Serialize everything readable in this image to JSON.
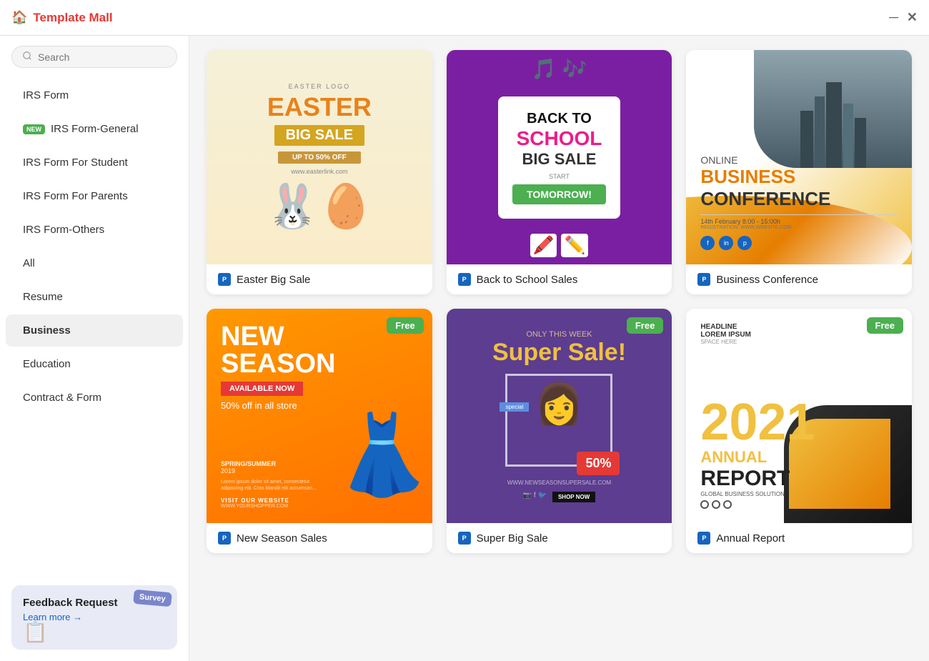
{
  "app": {
    "title": "Template Mall",
    "minimize_label": "minimize",
    "close_label": "close"
  },
  "search": {
    "placeholder": "Search"
  },
  "sidebar": {
    "items": [
      {
        "id": "irs-form",
        "label": "IRS Form",
        "active": false,
        "badge": null
      },
      {
        "id": "irs-form-general",
        "label": "IRS Form-General",
        "active": false,
        "badge": "NEW"
      },
      {
        "id": "irs-form-student",
        "label": "IRS Form For Student",
        "active": false,
        "badge": null
      },
      {
        "id": "irs-form-parents",
        "label": "IRS Form For Parents",
        "active": false,
        "badge": null
      },
      {
        "id": "irs-form-others",
        "label": "IRS Form-Others",
        "active": false,
        "badge": null
      },
      {
        "id": "all",
        "label": "All",
        "active": false,
        "badge": null
      },
      {
        "id": "resume",
        "label": "Resume",
        "active": false,
        "badge": null
      },
      {
        "id": "business",
        "label": "Business",
        "active": true,
        "badge": null
      },
      {
        "id": "education",
        "label": "Education",
        "active": false,
        "badge": null
      },
      {
        "id": "contract-form",
        "label": "Contract & Form",
        "active": false,
        "badge": null
      }
    ],
    "feedback": {
      "title": "Feedback Request",
      "link_label": "Learn more →",
      "survey_label": "Survey"
    }
  },
  "cards": [
    {
      "id": "easter-big-sale",
      "title": "Easter Big Sale",
      "type": "easter",
      "free": false,
      "details": {
        "logo": "EASTER LOGO",
        "main": "EASTER",
        "sub": "BIG SALE",
        "ribbon": "UP TO 50% OFF",
        "url": "www.easterlink.com"
      }
    },
    {
      "id": "back-to-school",
      "title": "Back to School Sales",
      "type": "school",
      "free": false,
      "details": {
        "back": "BACK TO",
        "school": "SCHOOL",
        "big": "BIG SALE",
        "start": "START",
        "tomorrow": "TOMORROW!"
      }
    },
    {
      "id": "business-conference",
      "title": "Business Conference",
      "type": "conference",
      "free": false,
      "details": {
        "online": "ONLINE",
        "business": "BUSINESS",
        "conference": "CONFERENCE",
        "date": "14th February  8:00 - 15:00h",
        "registration": "REGISTRATION: WWW.WEBSITE.COM"
      }
    },
    {
      "id": "new-season-sales",
      "title": "New Season Sales",
      "type": "newseason",
      "free": true,
      "details": {
        "new": "NEW",
        "season": "SEASON",
        "available": "AVAILABLE NOW",
        "off": "50% off in all store",
        "spring": "SPRING/SUMMER",
        "year": "2019",
        "visit": "VISIT OUR WEBSITE",
        "url": "WWW.YOURSHOPPER.COM"
      }
    },
    {
      "id": "super-big-sale",
      "title": "Super Big Sale",
      "type": "supersale",
      "free": true,
      "details": {
        "only": "ONLY THIS WEEK",
        "super": "Super Sale!",
        "percent": "50%",
        "url": "WWW.NEWSEASONSUPERSALE.COM",
        "shop": "SHOP NOW"
      }
    },
    {
      "id": "annual-report",
      "title": "Annual Report",
      "type": "annual",
      "free": true,
      "details": {
        "headline": "HEADLINE",
        "lorem": "LOREM IPSUM",
        "space": "SPACE HERE",
        "year": "2021",
        "annual": "ANNUAL",
        "report": "REPORT",
        "solution": "GLOBAL BUSINESS SOLUTION"
      }
    }
  ],
  "icons": {
    "search": "🔍",
    "home": "🏠",
    "ppt": "P",
    "minimize": "─",
    "close": "✕"
  }
}
